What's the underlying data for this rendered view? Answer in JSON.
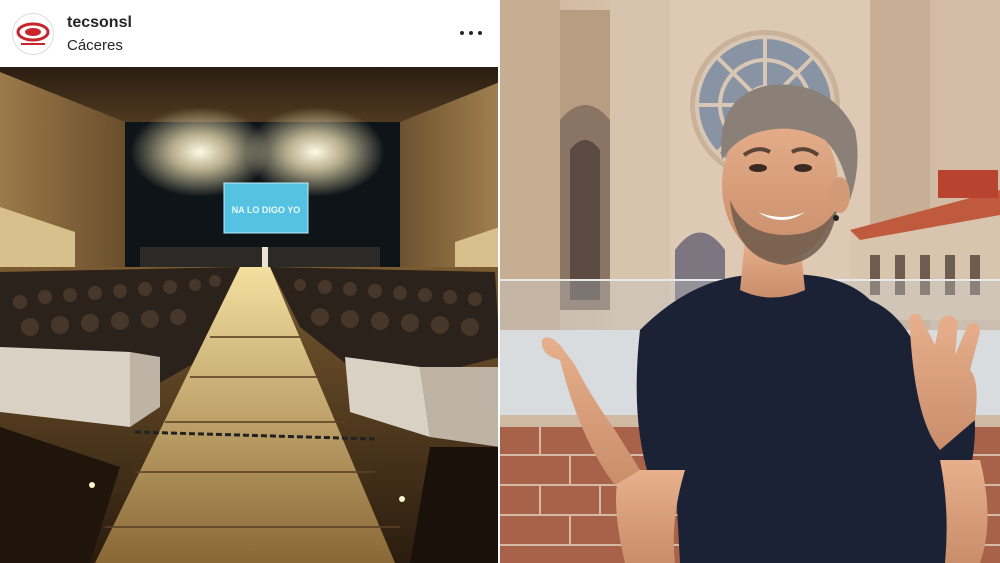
{
  "post": {
    "username": "tecsonsl",
    "location": "Cáceres",
    "avatar_icon": "tecson-logo-icon",
    "more_icon": "more-options-icon",
    "screen_text": "NA LO DIGO YO"
  },
  "colors": {
    "text": "#262626",
    "logo_red": "#c8262b",
    "stage_glow": "#fff6d8",
    "screen": "#56c2e2"
  }
}
